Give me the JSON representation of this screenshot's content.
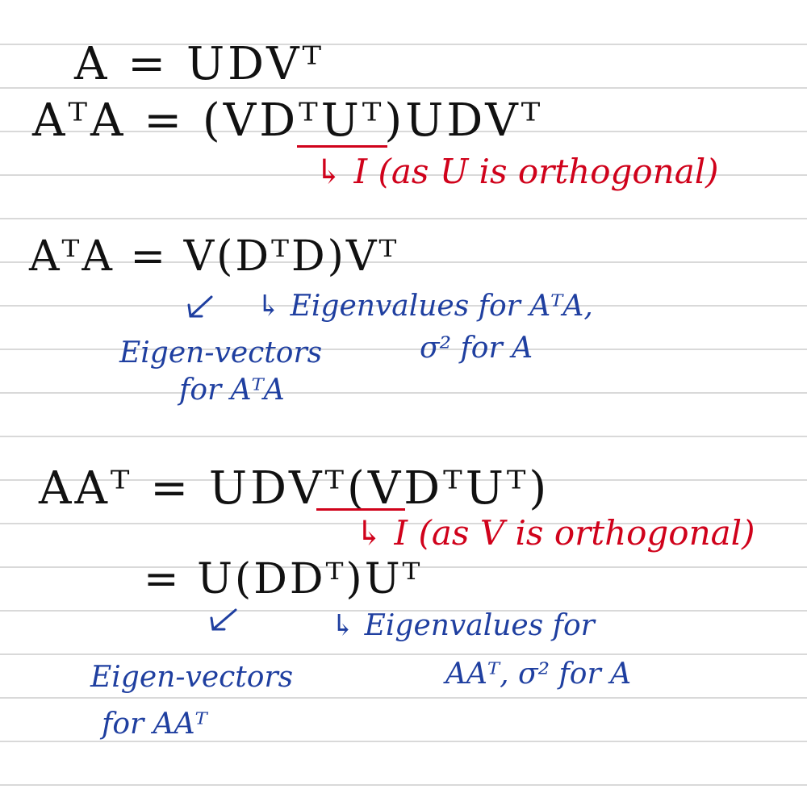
{
  "colors": {
    "ink": "#111111",
    "annotation_red": "#d0021b",
    "annotation_blue": "#1f3fa0",
    "rule_line": "#d9d9d9"
  },
  "lines": {
    "l1": "A =  UDVᵀ",
    "l2": "AᵀA = (VDᵀUᵀ)UDVᵀ",
    "l2_note": "↳ I (as U is orthogonal)",
    "l3": "AᵀA =  V(DᵀD)Vᵀ",
    "l3_eig": "↳ Eigenvalues for AᵀA,",
    "l3_sigma": "σ² for A",
    "l3_vec1": "Eigen-vectors",
    "l3_vec2": "for AᵀA",
    "l4": "AAᵀ =  UDVᵀ(VDᵀUᵀ)",
    "l4_note": "↳ I (as V is orthogonal)",
    "l5": "=   U(DDᵀ)Uᵀ",
    "l5_eig1": "↳ Eigenvalues for",
    "l5_eig2": "AAᵀ, σ² for A",
    "l5_vec1": "Eigen-vectors",
    "l5_vec2": "for AAᵀ"
  }
}
